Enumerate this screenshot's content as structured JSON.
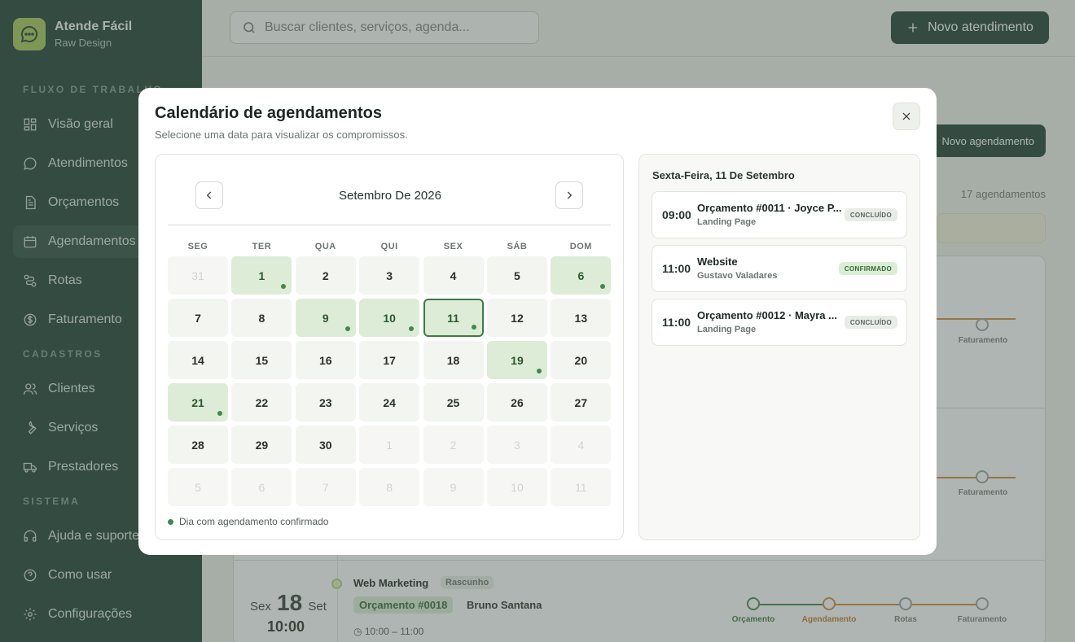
{
  "app": {
    "name": "Atende Fácil",
    "company": "Raw Design"
  },
  "sidebar": {
    "sections": [
      {
        "label": "FLUXO DE TRABALHO"
      },
      {
        "label": "CADASTROS"
      },
      {
        "label": "SISTEMA"
      }
    ],
    "items": [
      {
        "label": "Visão geral",
        "icon": "grid-icon"
      },
      {
        "label": "Atendimentos",
        "icon": "chat-icon"
      },
      {
        "label": "Orçamentos",
        "icon": "document-icon"
      },
      {
        "label": "Agendamentos",
        "icon": "calendar-icon",
        "active": true
      },
      {
        "label": "Rotas",
        "icon": "route-icon"
      },
      {
        "label": "Faturamento",
        "icon": "dollar-icon"
      },
      {
        "label": "Clientes",
        "icon": "users-icon"
      },
      {
        "label": "Serviços",
        "icon": "wrench-icon"
      },
      {
        "label": "Prestadores",
        "icon": "truck-icon"
      },
      {
        "label": "Ajuda e suporte",
        "icon": "headset-icon"
      },
      {
        "label": "Como usar",
        "icon": "help-icon"
      },
      {
        "label": "Configurações",
        "icon": "gear-icon"
      }
    ]
  },
  "header": {
    "search_placeholder": "Buscar clientes, serviços, agenda...",
    "new_service_label": "Novo atendimento"
  },
  "background": {
    "new_schedule_label": "Novo agendamento",
    "count_label": "17 agendamentos",
    "row": {
      "weekday": "Sex",
      "day": "18",
      "month": "Set",
      "time": "10:00",
      "title": "Web Marketing",
      "status": "Rascunho",
      "quote": "Orçamento #0018",
      "client": "Bruno Santana",
      "time_range": "10:00 – 11:00",
      "steps": [
        "Orçamento",
        "Agendamento",
        "Rotas",
        "Faturamento"
      ]
    },
    "step_label_top": "Faturamento"
  },
  "modal": {
    "title": "Calendário de agendamentos",
    "subtitle": "Selecione uma data para visualizar os compromissos.",
    "month_label": "Setembro De 2026",
    "weekdays": [
      "SEG",
      "TER",
      "QUA",
      "QUI",
      "SEX",
      "SÁB",
      "DOM"
    ],
    "days": [
      {
        "n": "31",
        "outside": true
      },
      {
        "n": "1",
        "has": true
      },
      {
        "n": "2"
      },
      {
        "n": "3"
      },
      {
        "n": "4"
      },
      {
        "n": "5"
      },
      {
        "n": "6",
        "has": true
      },
      {
        "n": "7"
      },
      {
        "n": "8"
      },
      {
        "n": "9",
        "has": true
      },
      {
        "n": "10",
        "has": true
      },
      {
        "n": "11",
        "has": true,
        "selected": true
      },
      {
        "n": "12"
      },
      {
        "n": "13"
      },
      {
        "n": "14"
      },
      {
        "n": "15"
      },
      {
        "n": "16"
      },
      {
        "n": "17"
      },
      {
        "n": "18"
      },
      {
        "n": "19",
        "has": true
      },
      {
        "n": "20"
      },
      {
        "n": "21",
        "has": true
      },
      {
        "n": "22"
      },
      {
        "n": "23"
      },
      {
        "n": "24"
      },
      {
        "n": "25"
      },
      {
        "n": "26"
      },
      {
        "n": "27"
      },
      {
        "n": "28"
      },
      {
        "n": "29"
      },
      {
        "n": "30"
      },
      {
        "n": "1",
        "outside": true
      },
      {
        "n": "2",
        "outside": true
      },
      {
        "n": "3",
        "outside": true
      },
      {
        "n": "4",
        "outside": true
      },
      {
        "n": "5",
        "outside": true
      },
      {
        "n": "6",
        "outside": true
      },
      {
        "n": "7",
        "outside": true
      },
      {
        "n": "8",
        "outside": true
      },
      {
        "n": "9",
        "outside": true
      },
      {
        "n": "10",
        "outside": true
      },
      {
        "n": "11",
        "outside": true
      }
    ],
    "legend": "Dia com agendamento confirmado",
    "selected_date_label": "Sexta-Feira, 11 De Setembro",
    "appointments": [
      {
        "time": "09:00",
        "title": "Orçamento #0011 · Joyce P...",
        "subtitle": "Landing Page",
        "status": "CONCLUÍDO",
        "kind": "done"
      },
      {
        "time": "11:00",
        "title": "Website",
        "subtitle": "Gustavo Valadares",
        "status": "CONFIRMADO",
        "kind": "conf"
      },
      {
        "time": "11:00",
        "title": "Orçamento #0012 · Mayra ...",
        "subtitle": "Landing Page",
        "status": "CONCLUÍDO",
        "kind": "done"
      }
    ]
  },
  "colors": {
    "sidebar_bg": "#1f3f33",
    "accent": "#a7c957",
    "highlight": "#ddecd6",
    "dot": "#3f8a4a"
  }
}
